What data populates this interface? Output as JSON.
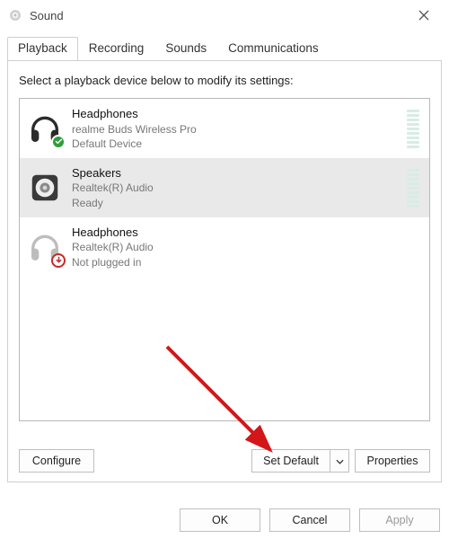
{
  "window": {
    "title": "Sound",
    "close_icon": "close"
  },
  "tabs": [
    {
      "label": "Playback",
      "active": true
    },
    {
      "label": "Recording",
      "active": false
    },
    {
      "label": "Sounds",
      "active": false
    },
    {
      "label": "Communications",
      "active": false
    }
  ],
  "instruction": "Select a playback device below to modify its settings:",
  "devices": [
    {
      "icon": "headphones",
      "badge": "ok",
      "name": "Headphones",
      "subtitle": "realme Buds Wireless Pro",
      "status": "Default Device",
      "selected": false,
      "level_style": "dim"
    },
    {
      "icon": "speaker",
      "badge": "",
      "name": "Speakers",
      "subtitle": "Realtek(R) Audio",
      "status": "Ready",
      "selected": true,
      "level_style": "dim"
    },
    {
      "icon": "headphones",
      "badge": "down",
      "name": "Headphones",
      "subtitle": "Realtek(R) Audio",
      "status": "Not plugged in",
      "selected": false,
      "level_style": "none"
    }
  ],
  "panel_buttons": {
    "configure": "Configure",
    "set_default": "Set Default",
    "properties": "Properties"
  },
  "footer_buttons": {
    "ok": "OK",
    "cancel": "Cancel",
    "apply": "Apply"
  }
}
